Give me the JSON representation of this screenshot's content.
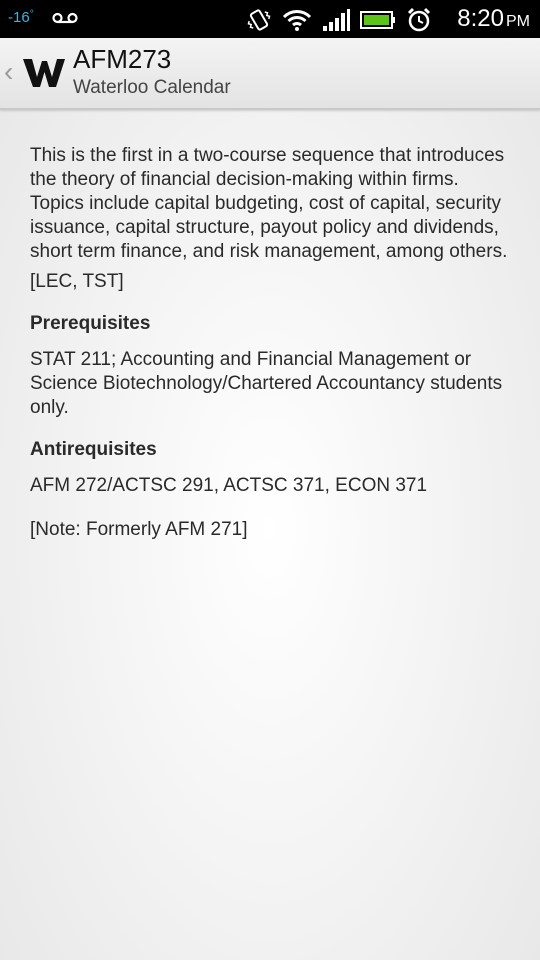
{
  "status_bar": {
    "temperature": "-16",
    "degree": "°",
    "time": "8:20",
    "ampm": "PM",
    "icons": [
      "voicemail-icon",
      "vibrate-icon",
      "wifi-icon",
      "signal-icon",
      "battery-icon",
      "alarm-icon"
    ],
    "accent_color": "#35b6e8"
  },
  "action_bar": {
    "title": "AFM273",
    "subtitle": "Waterloo Calendar",
    "logo_letter": "W",
    "back": "‹"
  },
  "course": {
    "description": "This is the first in a two-course sequence that introduces the theory of financial decision-making within firms. Topics include capital budgeting, cost of capital, security issuance, capital structure, payout policy and dividends, short term finance, and risk management, among others.",
    "components": "[LEC, TST]",
    "prerequisites_heading": "Prerequisites",
    "prerequisites": "STAT 211; Accounting and Financial Management or Science Biotechnology/Chartered Accountancy students only.",
    "antirequisites_heading": "Antirequisites",
    "antirequisites": "AFM 272/ACTSC 291, ACTSC 371, ECON 371",
    "note": "[Note: Formerly AFM 271]"
  }
}
